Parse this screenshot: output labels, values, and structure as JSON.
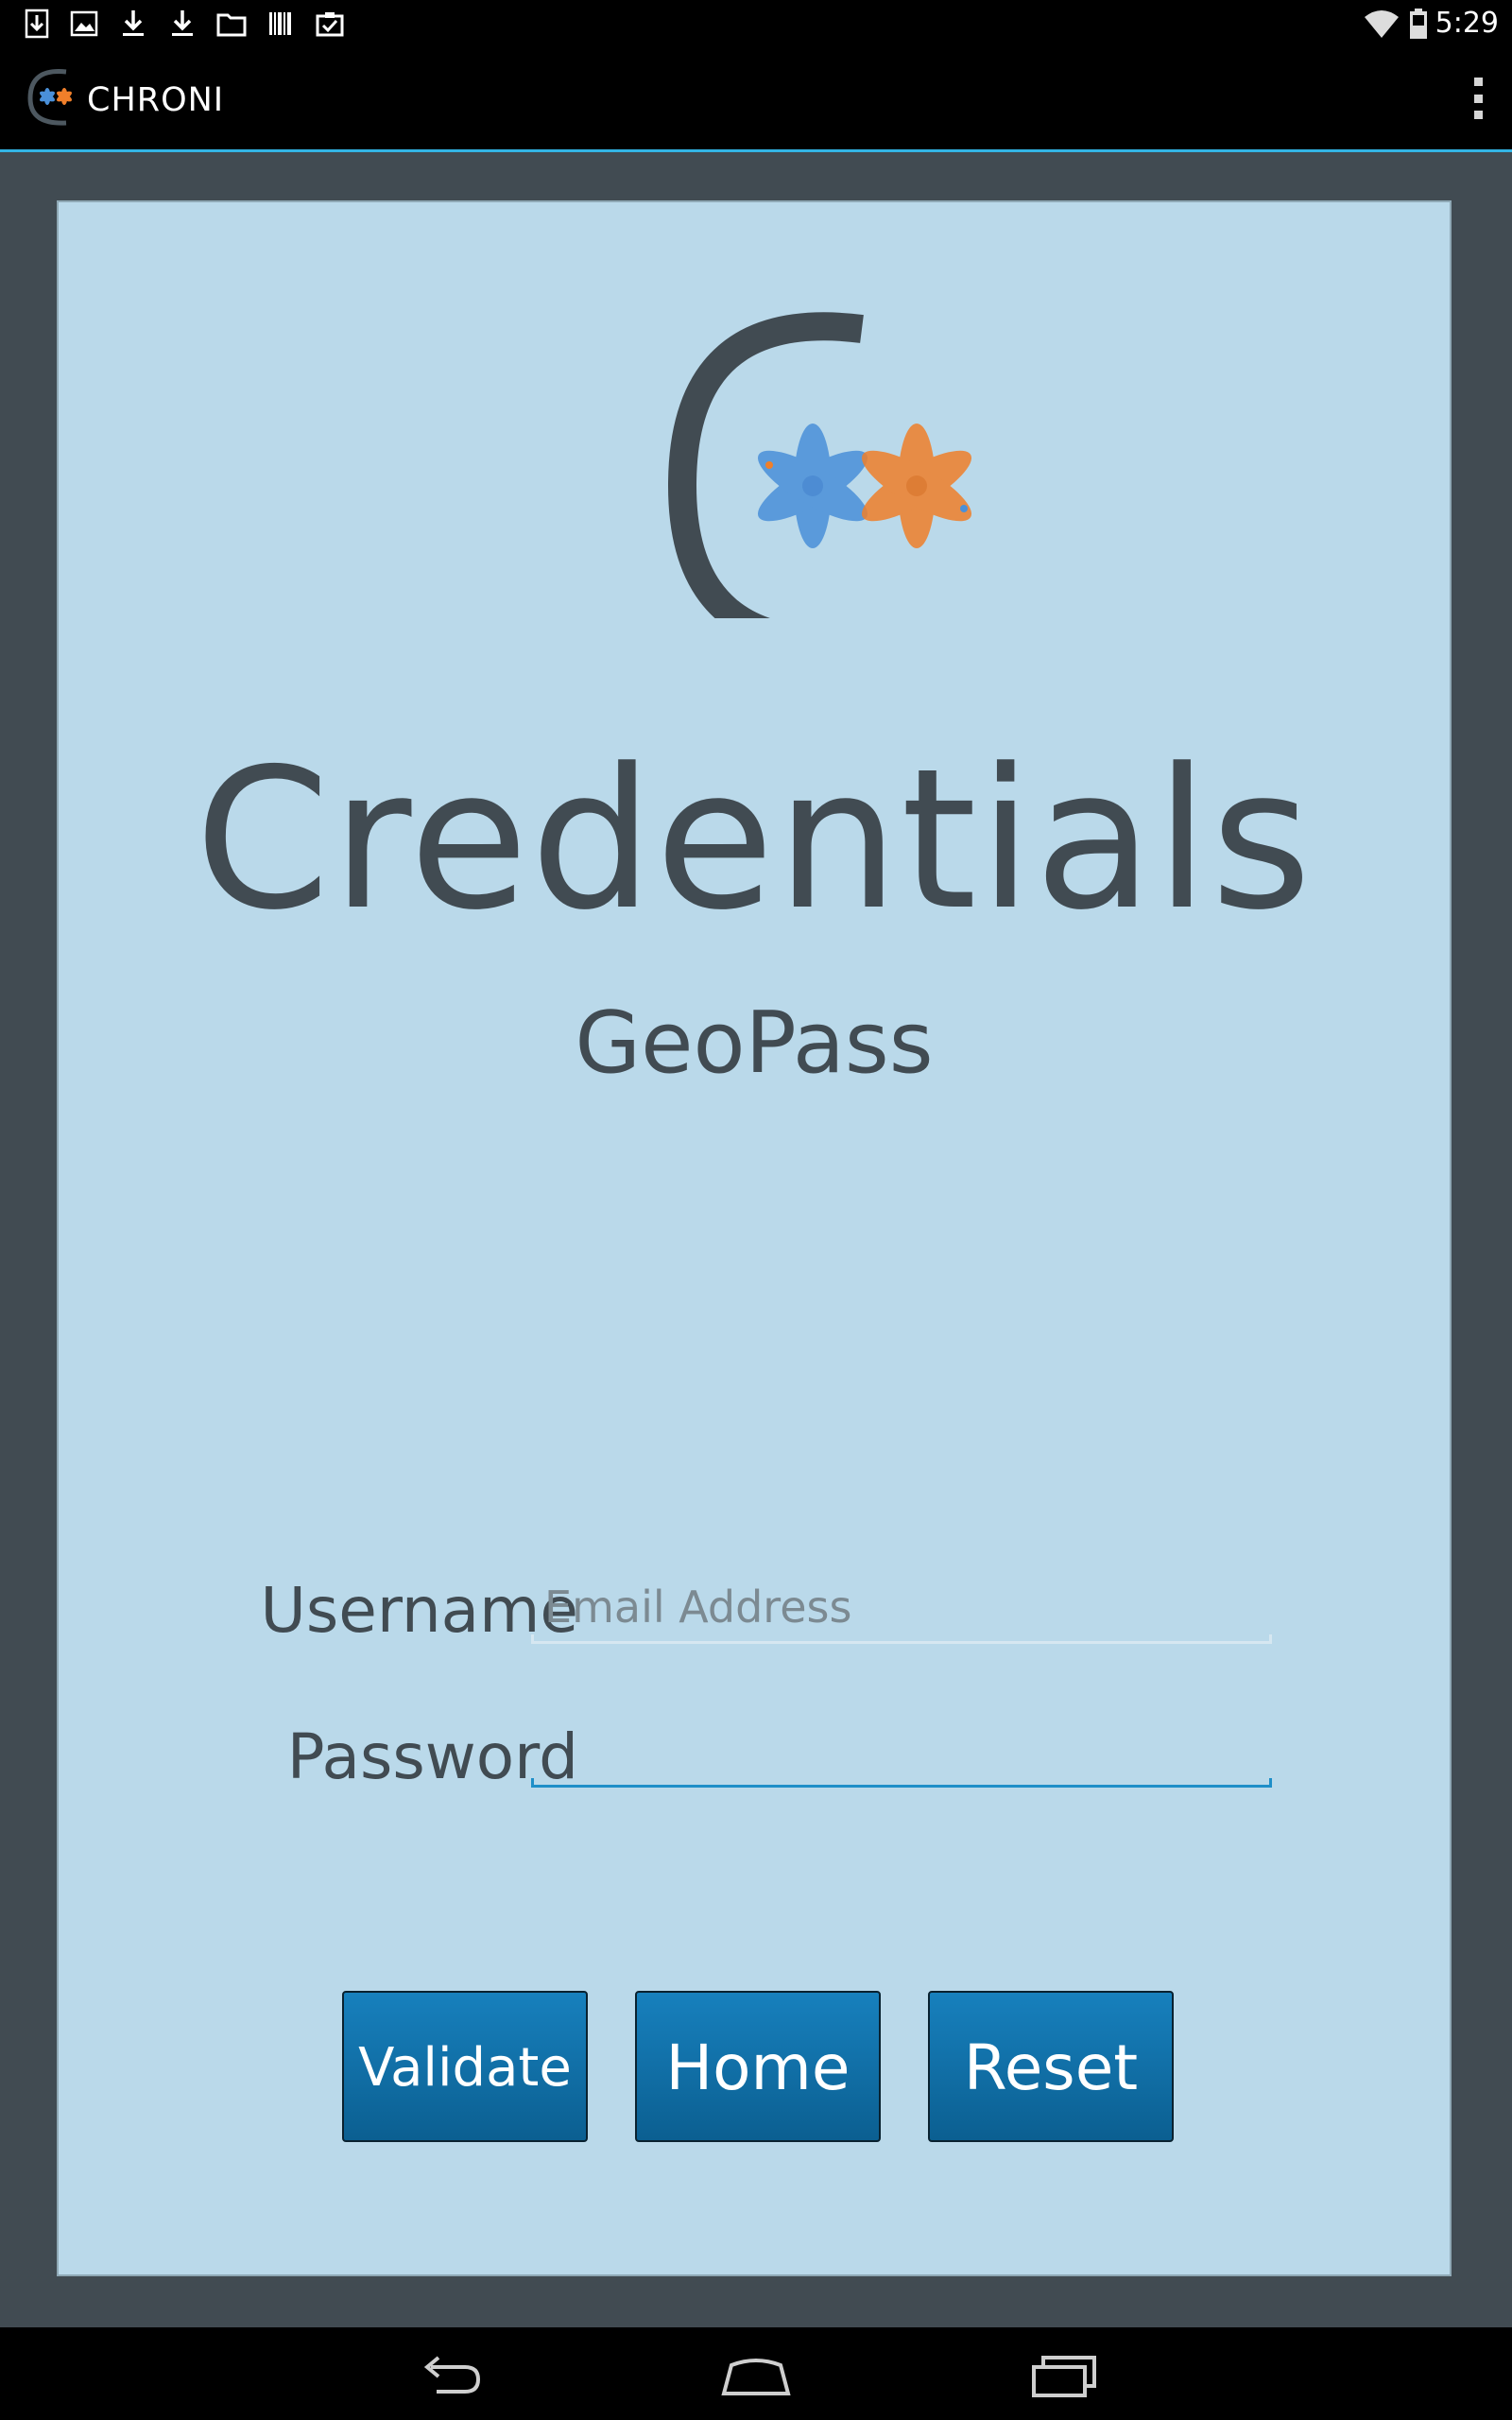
{
  "status_bar": {
    "time": "5:29",
    "notification_icons": [
      "download-box-icon",
      "image-icon",
      "download-icon",
      "download-icon",
      "folder-icon",
      "barcode-icon",
      "clipboard-check-icon"
    ],
    "system_icons": [
      "wifi-icon",
      "battery-icon"
    ]
  },
  "action_bar": {
    "title": "CHRONI",
    "overflow_icon": "overflow-menu-icon"
  },
  "content": {
    "heading": "Credentials",
    "subheading": "GeoPass",
    "username_label": "Username",
    "username_placeholder": "Email Address",
    "username_value": "",
    "password_label": "Password",
    "password_value": "",
    "buttons": {
      "validate": "Validate",
      "home": "Home",
      "reset": "Reset"
    }
  },
  "nav_bar": {
    "icons": [
      "back-icon",
      "home-icon",
      "recents-icon"
    ]
  },
  "colors": {
    "background": "#414b52",
    "card": "#bad9ea",
    "text": "#414b52",
    "accent": "#33b5e5",
    "button": "#1477b4",
    "logo_blue": "#4a90d9",
    "logo_orange": "#f07f2a"
  }
}
